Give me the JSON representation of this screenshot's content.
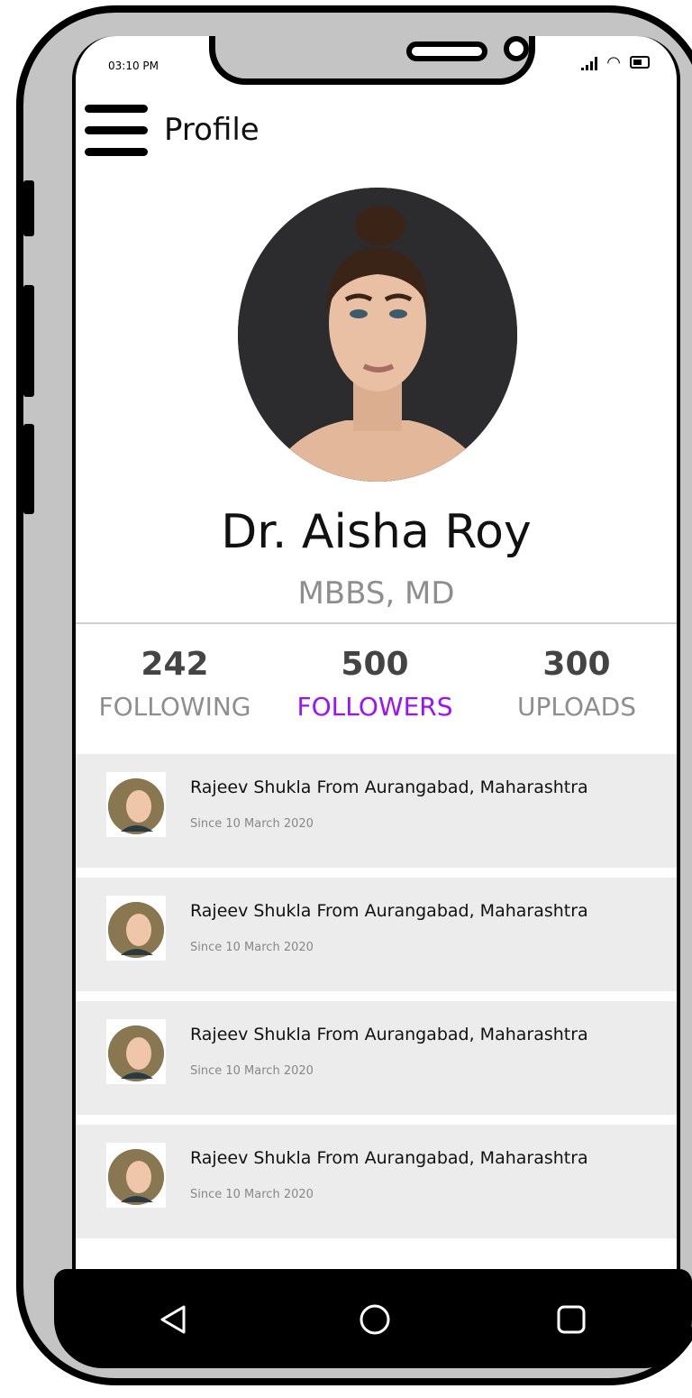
{
  "status_bar": {
    "time": "03:10 PM"
  },
  "header": {
    "title": "Profile",
    "menu_icon": "hamburger-menu-icon"
  },
  "profile": {
    "name": "Dr. Aisha  Roy",
    "degree": "MBBS, MD"
  },
  "stats": [
    {
      "count": "242",
      "label": "FOLLOWING"
    },
    {
      "count": "500",
      "label": "FOLLOWERS"
    },
    {
      "count": "300",
      "label": "UPLOADS"
    }
  ],
  "active_stat_color": "#9b11ff",
  "followers": [
    {
      "title": "Rajeev Shukla From Aurangabad, Maharashtra",
      "subtitle": "Since 10 March 2020"
    },
    {
      "title": "Rajeev Shukla From Aurangabad, Maharashtra",
      "subtitle": "Since 10 March 2020"
    },
    {
      "title": "Rajeev Shukla From Aurangabad, Maharashtra",
      "subtitle": "Since 10 March 2020"
    },
    {
      "title": "Rajeev Shukla From Aurangabad, Maharashtra",
      "subtitle": "Since 10 March 2020"
    }
  ],
  "nav": {
    "back": "back-triangle-icon",
    "home": "home-circle-icon",
    "recents": "recents-square-icon"
  }
}
